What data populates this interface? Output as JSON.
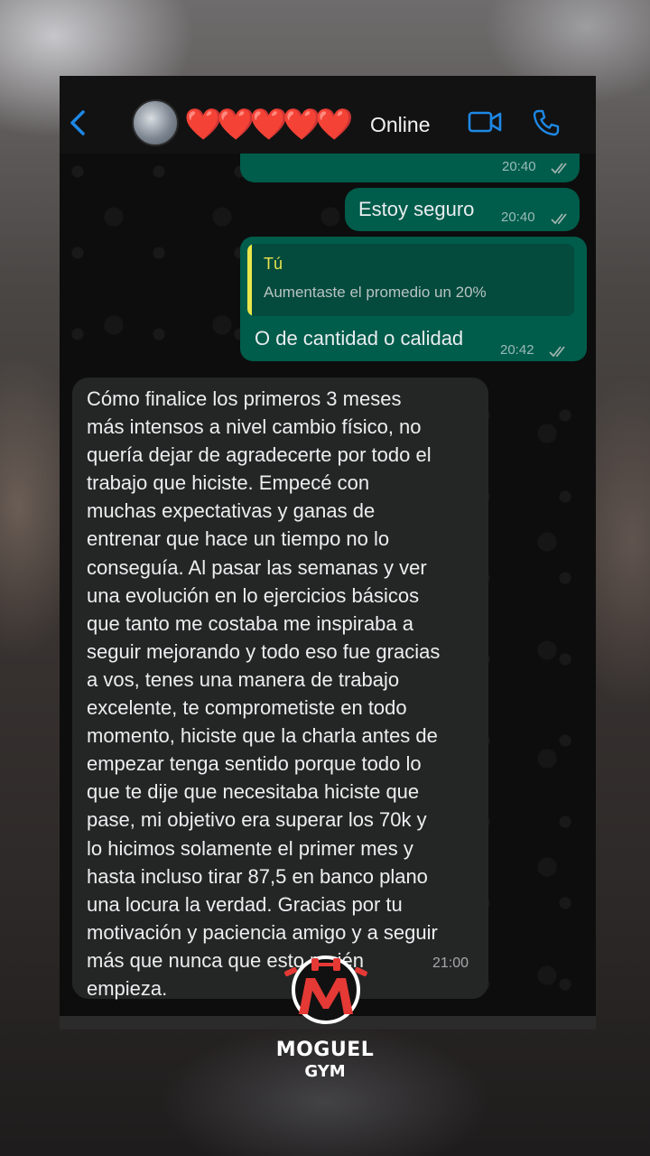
{
  "header": {
    "back_icon": "chevron-left-icon",
    "contact_name": "❤️❤️❤️❤️❤️",
    "status": "Online",
    "video_icon": "video-camera-icon",
    "call_icon": "phone-icon",
    "accent": "#1e88e5"
  },
  "messages": [
    {
      "direction": "out",
      "text": "",
      "time": "20:40",
      "status": "read"
    },
    {
      "direction": "out",
      "text": "Estoy seguro",
      "time": "20:40",
      "status": "read"
    },
    {
      "direction": "out",
      "quote": {
        "author": "Tú",
        "text": "Aumentaste el promedio un 20%"
      },
      "text": "O de cantidad o calidad",
      "time": "20:42",
      "status": "read"
    },
    {
      "direction": "in",
      "text": "Cómo finalice los primeros 3 meses\nmás intensos a nivel cambio físico, no\nquería dejar de agradecerte por todo el\ntrabajo que hiciste. Empecé con\nmuchas expectativas y ganas de\nentrenar que hace un tiempo no lo\nconseguía. Al pasar las semanas y ver\nuna evolución en lo ejercicios básicos\nque tanto me costaba me inspiraba a\nseguir mejorando y todo eso fue gracias\na vos, tenes una manera de trabajo\nexcelente, te comprometiste en todo\nmomento, hiciste que la charla antes de\nempezar tenga sentido porque todo lo\nque te dije que necesitaba hiciste que\npase, mi objetivo era superar los 70k y\nlo hicimos solamente el primer mes y\nhasta incluso tirar 87,5 en banco plano\nuna locura la verdad. Gracias por tu\nmotivación y paciencia amigo y a seguir\nmás que nunca que esto recién\nempieza.",
      "time": "21:00"
    }
  ],
  "colors": {
    "outgoing_bubble": "#005c4b",
    "incoming_bubble": "#242626",
    "quote_accent": "#e8e64b",
    "read_ticks": "#9fb3ae"
  },
  "brand": {
    "logo_icon": "moguel-gym-logo",
    "line1": "MOGUEL",
    "line2": "GYM"
  }
}
